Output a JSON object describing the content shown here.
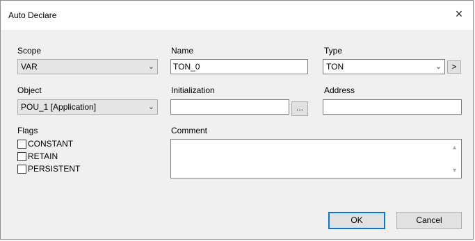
{
  "window": {
    "title": "Auto Declare",
    "close_glyph": "×"
  },
  "scope": {
    "label": "Scope",
    "value": "VAR"
  },
  "name": {
    "label": "Name",
    "value": "TON_0"
  },
  "type": {
    "label": "Type",
    "value": "TON",
    "browse_label": ">"
  },
  "object": {
    "label": "Object",
    "value": "POU_1 [Application]"
  },
  "initialization": {
    "label": "Initialization",
    "value": "",
    "browse_label": "..."
  },
  "address": {
    "label": "Address",
    "value": ""
  },
  "flags": {
    "label": "Flags",
    "items": [
      {
        "label": "CONSTANT",
        "checked": false
      },
      {
        "label": "RETAIN",
        "checked": false
      },
      {
        "label": "PERSISTENT",
        "checked": false
      }
    ]
  },
  "comment": {
    "label": "Comment",
    "value": ""
  },
  "buttons": {
    "ok": "OK",
    "cancel": "Cancel"
  }
}
